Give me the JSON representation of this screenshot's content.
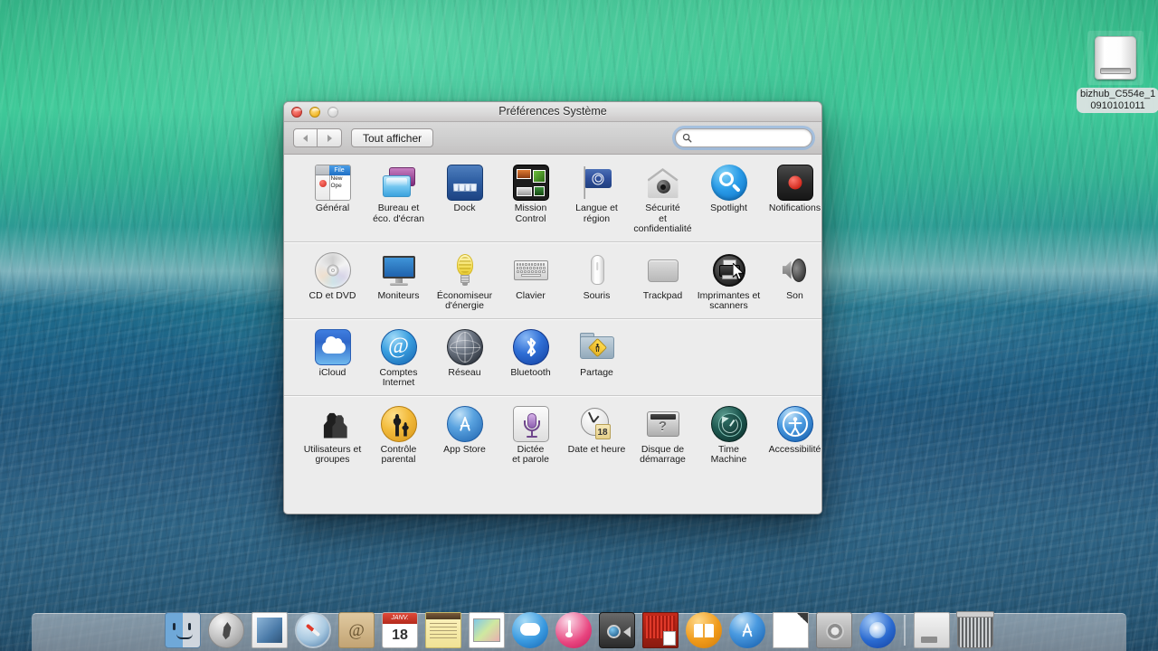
{
  "desktop": {
    "drive": {
      "icon": "external-drive-icon",
      "label_line1": "bizhub_C554e_1",
      "label_line2": "0910101011"
    },
    "wallpaper_colors": {
      "top_green": "#3ec998",
      "mid_teal": "#2c9a93",
      "bottom_blue": "#22587c"
    }
  },
  "window": {
    "title": "Préférences Système",
    "traffic_lights": {
      "close": "close-button",
      "minimize": "minimize-button",
      "zoom": "zoom-button"
    },
    "toolbar": {
      "back_label": "◀",
      "forward_label": "▶",
      "show_all_label": "Tout afficher",
      "search": {
        "value": "",
        "placeholder": "",
        "icon": "search-icon"
      }
    },
    "rows": [
      {
        "id": "personal",
        "items": [
          {
            "icon": "general-icon",
            "lines": [
              "Général"
            ]
          },
          {
            "icon": "desktop-saver-icon",
            "lines": [
              "Bureau et",
              "éco. d'écran"
            ]
          },
          {
            "icon": "dock-icon",
            "lines": [
              "Dock"
            ]
          },
          {
            "icon": "mission-control-icon",
            "lines": [
              "Mission",
              "Control"
            ]
          },
          {
            "icon": "language-region-icon",
            "lines": [
              "Langue et",
              "région"
            ]
          },
          {
            "icon": "security-icon",
            "lines": [
              "Sécurité",
              "et confidentialité"
            ]
          },
          {
            "icon": "spotlight-icon",
            "lines": [
              "Spotlight"
            ]
          },
          {
            "icon": "notifications-icon",
            "lines": [
              "Notifications"
            ]
          }
        ]
      },
      {
        "id": "hardware",
        "items": [
          {
            "icon": "cd-dvd-icon",
            "lines": [
              "CD et DVD"
            ]
          },
          {
            "icon": "displays-icon",
            "lines": [
              "Moniteurs"
            ]
          },
          {
            "icon": "energy-saver-icon",
            "lines": [
              "Économiseur",
              "d'énergie"
            ]
          },
          {
            "icon": "keyboard-icon",
            "lines": [
              "Clavier"
            ]
          },
          {
            "icon": "mouse-icon",
            "lines": [
              "Souris"
            ]
          },
          {
            "icon": "trackpad-icon",
            "lines": [
              "Trackpad"
            ]
          },
          {
            "icon": "printers-scanners-icon",
            "lines": [
              "Imprimantes et",
              "scanners"
            ]
          },
          {
            "icon": "sound-icon",
            "lines": [
              "Son"
            ]
          }
        ]
      },
      {
        "id": "internet",
        "items": [
          {
            "icon": "icloud-icon",
            "lines": [
              "iCloud"
            ]
          },
          {
            "icon": "internet-accounts-icon",
            "lines": [
              "Comptes",
              "Internet"
            ]
          },
          {
            "icon": "network-icon",
            "lines": [
              "Réseau"
            ]
          },
          {
            "icon": "bluetooth-icon",
            "lines": [
              "Bluetooth"
            ]
          },
          {
            "icon": "sharing-icon",
            "lines": [
              "Partage"
            ]
          }
        ]
      },
      {
        "id": "system",
        "items": [
          {
            "icon": "users-groups-icon",
            "lines": [
              "Utilisateurs et",
              "groupes"
            ]
          },
          {
            "icon": "parental-controls-icon",
            "lines": [
              "Contrôle",
              "parental"
            ]
          },
          {
            "icon": "app-store-icon",
            "lines": [
              "App Store"
            ]
          },
          {
            "icon": "dictation-speech-icon",
            "lines": [
              "Dictée",
              "et parole"
            ]
          },
          {
            "icon": "date-time-icon",
            "lines": [
              "Date et heure"
            ]
          },
          {
            "icon": "startup-disk-icon",
            "lines": [
              "Disque de",
              "démarrage"
            ]
          },
          {
            "icon": "time-machine-icon",
            "lines": [
              "Time",
              "Machine"
            ]
          },
          {
            "icon": "accessibility-icon",
            "lines": [
              "Accessibilité"
            ]
          }
        ]
      }
    ],
    "date_badge": "18",
    "cursor": {
      "over": "printers-scanners-icon",
      "glyph": "arrow-cursor"
    }
  },
  "dock": {
    "items": [
      {
        "icon": "finder-icon"
      },
      {
        "icon": "launchpad-icon"
      },
      {
        "icon": "mail-icon"
      },
      {
        "icon": "safari-icon"
      },
      {
        "icon": "contacts-icon"
      },
      {
        "icon": "calendar-icon",
        "badge_month": "JANV.",
        "badge_day": "18"
      },
      {
        "icon": "notes-icon"
      },
      {
        "icon": "preview-icon"
      },
      {
        "icon": "messages-icon"
      },
      {
        "icon": "itunes-icon"
      },
      {
        "icon": "facetime-icon"
      },
      {
        "icon": "iphoto-icon"
      },
      {
        "icon": "ibooks-icon"
      },
      {
        "icon": "app-store-icon"
      },
      {
        "icon": "pages-document-icon"
      },
      {
        "icon": "system-preferences-icon"
      },
      {
        "icon": "time-capsule-icon"
      },
      {
        "icon": "downloads-stack-icon"
      },
      {
        "icon": "trash-icon"
      }
    ]
  }
}
